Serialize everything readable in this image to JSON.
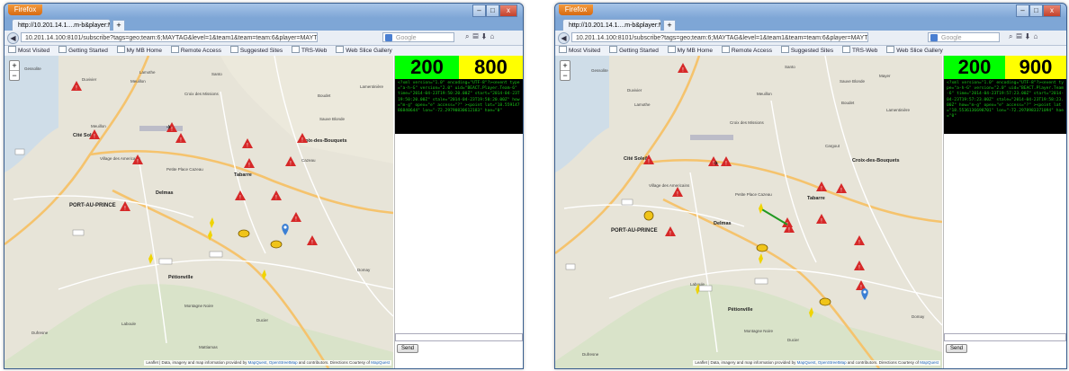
{
  "windows": [
    {
      "id": "left",
      "browser": {
        "app_button": "Firefox",
        "tab_title": "http://10.201.14.1....m-b&player:MAYTAG",
        "new_tab": "+",
        "url": "10.201.14.100:8101/subscribe?tags=geo;team:6;MAYTAG&level=1&team1&team=team:6&player=MAYTAG",
        "search_placeholder": "Google",
        "controls": {
          "min": "–",
          "max": "□",
          "close": "x"
        },
        "bookmarks": [
          "Most Visited",
          "Getting Started",
          "My MB Home",
          "Remote Access",
          "Suggested Sites",
          "TRS-Web",
          "Web Slice Gallery"
        ]
      },
      "map": {
        "zoom_in": "+",
        "zoom_out": "−",
        "labels": {
          "cite_soleil": "Cité Soleil",
          "port_au_prince": "PORT-AU-PRINCE",
          "croix_des_bouquets": "Croix-des-Bouquets",
          "delmas": "Delmas",
          "tabarre": "Tabarre",
          "petionville": "Pétionville",
          "village_des_americains": "Village des Americains",
          "petite_place_cazeau": "Petite Place Cazeau",
          "croix_des_missions": "Croix des Missions",
          "duvivier": "Duvivier",
          "lamothe": "Lamothe",
          "meuillon": "Meuillon",
          "santo": "Santo",
          "sauve_blonde": "Sauve Blonde",
          "gessolite": "Gessolite",
          "boudet": "Boudet",
          "lamentinière": "Lamentinière",
          "montagne_noire": "Montagne Noire",
          "laboule": "Laboule",
          "dufresne": "Dufresne",
          "ducier": "Ducier",
          "domay": "Domay",
          "mattiamas": "Mattiamas",
          "cazeau": "Cazeau"
        },
        "attribution_prefix": "Leaflet | Data, imagery and map information provided by",
        "attribution_links": [
          "MapQuest",
          "OpenStreetMap"
        ],
        "attribution_suffix": "and contributors. Directions Courtesy of",
        "attribution_last": "MapQuest"
      },
      "panel": {
        "counter_green": "200",
        "counter_yellow": "800",
        "xml": "<?xml version=\"1.0\" encoding=\"UTF-8\"?><event type=\"a-h-G\" version=\"2.0\" uid=\"BEACT.Player.Team-6\" time=\"2014-04-23T19:50:20.00Z\" start=\"2014-04-23T19:50:20.00Z\" stale=\"2014-04-23T19:50:20.00Z\" how=\"m-g\" opex=\"e\" access=\"?\" ><point lat=\"18.55914786840644\" lon=\"-72.29790830612183\" hae=\"0\"",
        "send_label": "Send"
      }
    },
    {
      "id": "right",
      "browser": {
        "app_button": "Firefox",
        "tab_title": "http://10.201.14.1....m-b&player:MAYTAG",
        "new_tab": "+",
        "url": "10.201.14.100:8101/subscribe?tags=geo;team:6;MAYTAG&level=1&team1&team=team:6&player=MAYTAG",
        "search_placeholder": "Google",
        "controls": {
          "min": "–",
          "max": "□",
          "close": "x"
        },
        "bookmarks": [
          "Most Visited",
          "Getting Started",
          "My MB Home",
          "Remote Access",
          "Suggested Sites",
          "TRS-Web",
          "Web Slice Gallery"
        ]
      },
      "map": {
        "zoom_in": "+",
        "zoom_out": "−",
        "labels": {
          "cite_soleil": "Cité Soleil",
          "port_au_prince": "PORT-AU-PRINCE",
          "croix_des_bouquets": "Croix-des-Bouquets",
          "delmas": "Delmas",
          "tabarre": "Tabarre",
          "petionville": "Pétionville",
          "village_des_americains": "Village des Americains",
          "petite_place_cazeau": "Petite Place Cazeau",
          "croix_des_missions": "Croix des Missions",
          "duvivier": "Duvivier",
          "lamothe": "Lamothe",
          "meuillon": "Meuillon",
          "santo": "Santo",
          "sauve_blonde": "Sauve Blonde",
          "gessolite": "Gessolite",
          "boudet": "Boudet",
          "lamentinière": "Lamentinière",
          "montagne_noire": "Montagne Noire",
          "laboule": "Laboule",
          "dufresne": "Dufresne",
          "ducier": "Ducier",
          "domay": "Domay",
          "mattiamas": "Mayer",
          "cazeau": "Cargout"
        },
        "attribution_prefix": "Leaflet | Data, imagery and map information provided by",
        "attribution_links": [
          "MapQuest",
          "OpenStreetMap"
        ],
        "attribution_suffix": "and contributors. Directions Courtesy of",
        "attribution_last": "MapQuest"
      },
      "panel": {
        "counter_green": "200",
        "counter_yellow": "900",
        "xml": "<?xml version=\"1.0\" encoding=\"UTF-8\"?><event type=\"a-h-G\" version=\"2.0\" uid=\"BEACT.Player.Team-6\" time=\"2014-04-23T19:57:23.00Z\" start=\"2014-04-23T19:57:23.00Z\" stale=\"2014-04-23T19:58:23.00Z\" how=\"m-g\" opex=\"e\" access=\"?\" ><point lat=\"18.5536136698701\" lon=\"-72.2978983371094\" hae=\"0\"",
        "send_label": "Send"
      }
    }
  ]
}
